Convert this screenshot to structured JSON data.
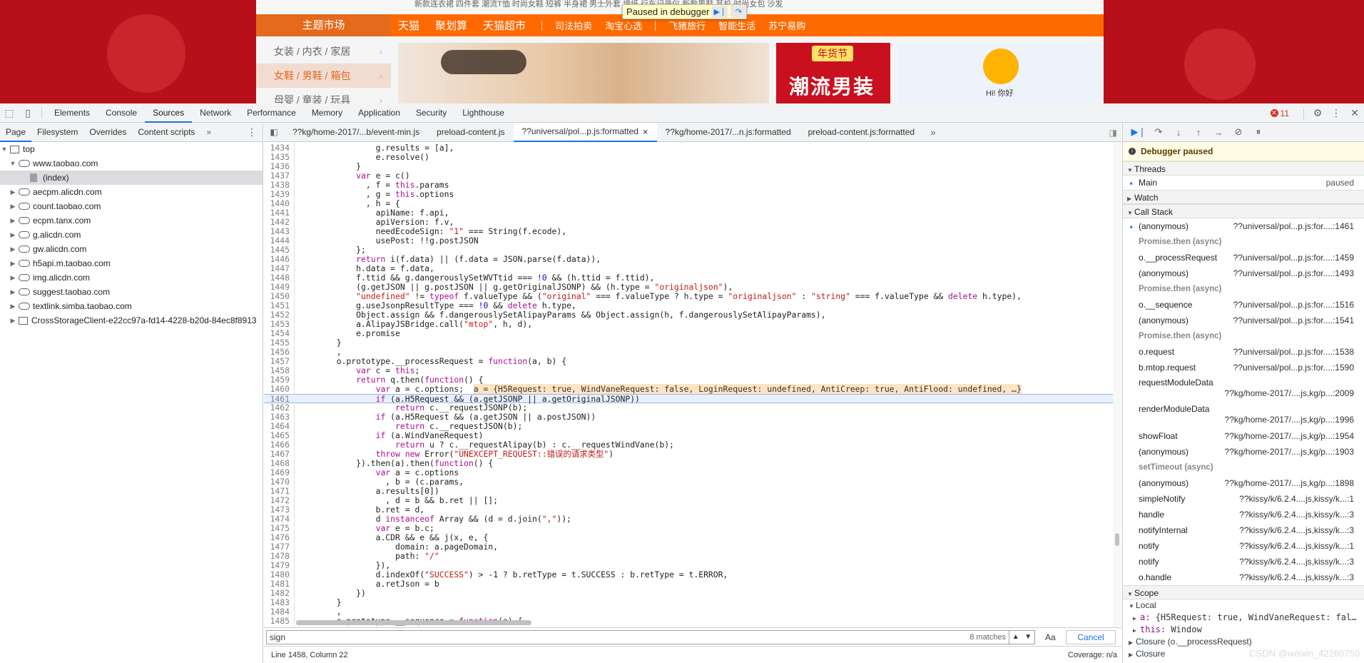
{
  "webpage": {
    "top_strip_text": "新款连衣裙 四件套 潮流T恤 时尚女鞋 短裤 半身裙 男士外套 墙纸 行车记录仪 新款男鞋 耳机 时尚女包 沙发",
    "theme_market": "主题市场",
    "nav": [
      "天猫",
      "聚划算",
      "天猫超市"
    ],
    "nav_small": [
      "司法拍卖",
      "淘宝心选",
      "飞猪旅行",
      "智能生活",
      "苏宁易购"
    ],
    "categories": [
      "女装 / 内衣 / 家居",
      "女鞋 / 男鞋 / 箱包",
      "母婴 / 童装 / 玩具"
    ],
    "banner2_tag": "年货节",
    "banner2_text": "潮流男装",
    "banner3_greeting": "Hi! 你好",
    "paused_overlay": "Paused in debugger"
  },
  "devtools": {
    "main_tabs": [
      "Elements",
      "Console",
      "Sources",
      "Network",
      "Performance",
      "Memory",
      "Application",
      "Security",
      "Lighthouse"
    ],
    "active_tab": "Sources",
    "error_count": "11",
    "navigator_tabs": [
      "Page",
      "Filesystem",
      "Overrides",
      "Content scripts"
    ],
    "tree": {
      "top": "top",
      "host": "www.taobao.com",
      "index": "(index)",
      "domains": [
        "aecpm.alicdn.com",
        "count.taobao.com",
        "ecpm.tanx.com",
        "g.alicdn.com",
        "gw.alicdn.com",
        "h5api.m.taobao.com",
        "img.alicdn.com",
        "suggest.taobao.com",
        "textlink.simba.taobao.com"
      ],
      "frame": "CrossStorageClient-e22cc97a-fd14-4228-b20d-84ec8f8913"
    },
    "file_tabs": [
      "??kg/home-2017/...b/event-min.js",
      "preload-content.js",
      "??universal/pol...p.js:formatted",
      "??kg/home-2017/...n.js:formatted",
      "preload-content.js:formatted"
    ],
    "active_file_tab": "??universal/pol...p.js:formatted",
    "search": {
      "query": "sign",
      "matches": "8 matches",
      "case_label": "Aa",
      "regex_label": ".*",
      "cancel": "Cancel"
    },
    "status": {
      "position": "Line 1458, Column 22",
      "coverage": "Coverage: n/a"
    },
    "debugger": {
      "paused": "Debugger paused",
      "threads_title": "Threads",
      "thread_name": "Main",
      "thread_state": "paused",
      "watch_title": "Watch",
      "callstack_title": "Call Stack",
      "scope_title": "Scope",
      "frames": [
        {
          "kind": "frame",
          "fn": "(anonymous)",
          "loc": "??universal/pol...p.js:for....:1461",
          "current": true
        },
        {
          "kind": "async",
          "label": "Promise.then (async)"
        },
        {
          "kind": "frame",
          "fn": "o.__processRequest",
          "loc": "??universal/pol...p.js:for....:1459"
        },
        {
          "kind": "frame",
          "fn": "(anonymous)",
          "loc": "??universal/pol...p.js:for....:1493"
        },
        {
          "kind": "async",
          "label": "Promise.then (async)"
        },
        {
          "kind": "frame",
          "fn": "o.__sequence",
          "loc": "??universal/pol...p.js:for....:1516"
        },
        {
          "kind": "frame",
          "fn": "(anonymous)",
          "loc": "??universal/pol...p.js:for....:1541"
        },
        {
          "kind": "async",
          "label": "Promise.then (async)"
        },
        {
          "kind": "frame",
          "fn": "o.request",
          "loc": "??universal/pol...p.js:for....:1538"
        },
        {
          "kind": "frame",
          "fn": "b.mtop.request",
          "loc": "??universal/pol...p.js:for....:1590"
        },
        {
          "kind": "tall",
          "fn": "requestModuleData",
          "loc": "??kg/home-2017/....js,kg/p...:2009"
        },
        {
          "kind": "tall",
          "fn": "renderModuleData",
          "loc": "??kg/home-2017/....js,kg/p...:1996"
        },
        {
          "kind": "frame",
          "fn": "showFloat",
          "loc": "??kg/home-2017/....js,kg/p...:1954"
        },
        {
          "kind": "frame",
          "fn": "(anonymous)",
          "loc": "??kg/home-2017/....js,kg/p...:1903"
        },
        {
          "kind": "async",
          "label": "setTimeout (async)"
        },
        {
          "kind": "frame",
          "fn": "(anonymous)",
          "loc": "??kg/home-2017/....js,kg/p...:1898"
        },
        {
          "kind": "frame",
          "fn": "simpleNotify",
          "loc": "??kissy/k/6.2.4....js,kissy/k...:1"
        },
        {
          "kind": "frame",
          "fn": "handle",
          "loc": "??kissy/k/6.2.4....js,kissy/k...:3"
        },
        {
          "kind": "frame",
          "fn": "notifyInternal",
          "loc": "??kissy/k/6.2.4....js,kissy/k...:3"
        },
        {
          "kind": "frame",
          "fn": "notify",
          "loc": "??kissy/k/6.2.4....js,kissy/k...:1"
        },
        {
          "kind": "frame",
          "fn": "notify",
          "loc": "??kissy/k/6.2.4....js,kissy/k...:3"
        },
        {
          "kind": "frame",
          "fn": "o.handle",
          "loc": "??kissy/k/6.2.4....js,kissy/k...:3"
        }
      ],
      "scope": {
        "local": "Local",
        "a_key": "a:",
        "a_val": "{H5Request: true, WindVaneRequest: fal…",
        "this_key": "this:",
        "this_val": "Window",
        "closure1": "Closure (o.__processRequest)",
        "closure2": "Closure"
      },
      "watermark": "CSDN @weixin_42260750"
    },
    "code_lines": [
      {
        "n": "1434",
        "t": "                g.results = [a],"
      },
      {
        "n": "1435",
        "t": "                e.resolve()"
      },
      {
        "n": "1436",
        "t": "            }"
      },
      {
        "n": "1437",
        "t": "            var e = c()"
      },
      {
        "n": "1438",
        "t": "              , f = this.params"
      },
      {
        "n": "1439",
        "t": "              , g = this.options"
      },
      {
        "n": "1440",
        "t": "              , h = {"
      },
      {
        "n": "1441",
        "t": "                apiName: f.api,"
      },
      {
        "n": "1442",
        "t": "                apiVersion: f.v,"
      },
      {
        "n": "1443",
        "t": "                needEcodeSign: \"1\" === String(f.ecode),"
      },
      {
        "n": "1444",
        "t": "                usePost: !!g.postJSON"
      },
      {
        "n": "1445",
        "t": "            };"
      },
      {
        "n": "1446",
        "t": "            return i(f.data) || (f.data = JSON.parse(f.data)),"
      },
      {
        "n": "1447",
        "t": "            h.data = f.data,"
      },
      {
        "n": "1448",
        "t": "            f.ttid && g.dangerouslySetWVTtid === !0 && (h.ttid = f.ttid),"
      },
      {
        "n": "1449",
        "t": "            (g.getJSON || g.postJSON || g.getOriginalJSONP) && (h.type = \"originaljson\"),"
      },
      {
        "n": "1450",
        "t": "            \"undefined\" != typeof f.valueType && (\"original\" === f.valueType ? h.type = \"originaljson\" : \"string\" === f.valueType && delete h.type),"
      },
      {
        "n": "1451",
        "t": "            g.useJsonpResultType === !0 && delete h.type,"
      },
      {
        "n": "1452",
        "t": "            Object.assign && f.dangerouslySetAlipayParams && Object.assign(h, f.dangerouslySetAlipayParams),"
      },
      {
        "n": "1453",
        "t": "            a.AlipayJSBridge.call(\"mtop\", h, d),"
      },
      {
        "n": "1454",
        "t": "            e.promise"
      },
      {
        "n": "1455",
        "t": "        }"
      },
      {
        "n": "1456",
        "t": "        ,"
      },
      {
        "n": "1457",
        "t": "        o.prototype.__processRequest = function(a, b) {"
      },
      {
        "n": "1458",
        "t": "            var c = this;"
      },
      {
        "n": "1459",
        "t": "            return q.then(function() {"
      },
      {
        "n": "1460",
        "t": "                var a = c.options;",
        "inline": "a = {H5Request: true, WindVaneRequest: false, LoginRequest: undefined, AntiCreep: true, AntiFlood: undefined, …}"
      },
      {
        "n": "1461",
        "t": "                if (a.H5Request && (a.getJSONP || a.getOriginalJSONP))",
        "exec": true
      },
      {
        "n": "1462",
        "t": "                    return c.__requestJSONP(b);"
      },
      {
        "n": "1463",
        "t": "                if (a.H5Request && (a.getJSON || a.postJSON))"
      },
      {
        "n": "1464",
        "t": "                    return c.__requestJSON(b);"
      },
      {
        "n": "1465",
        "t": "                if (a.WindVaneRequest)"
      },
      {
        "n": "1466",
        "t": "                    return u ? c.__requestAlipay(b) : c.__requestWindVane(b);"
      },
      {
        "n": "1467",
        "t": "                throw new Error(\"UNEXCEPT_REQUEST::错误的请求类型\")"
      },
      {
        "n": "1468",
        "t": "            }).then(a).then(function() {"
      },
      {
        "n": "1469",
        "t": "                var a = c.options"
      },
      {
        "n": "1470",
        "t": "                  , b = (c.params,"
      },
      {
        "n": "1471",
        "t": "                a.results[0])"
      },
      {
        "n": "1472",
        "t": "                  , d = b && b.ret || [];"
      },
      {
        "n": "1473",
        "t": "                b.ret = d,"
      },
      {
        "n": "1474",
        "t": "                d instanceof Array && (d = d.join(\",\"));"
      },
      {
        "n": "1475",
        "t": "                var e = b.c;"
      },
      {
        "n": "1476",
        "t": "                a.CDR && e && j(x, e, {"
      },
      {
        "n": "1477",
        "t": "                    domain: a.pageDomain,"
      },
      {
        "n": "1478",
        "t": "                    path: \"/\""
      },
      {
        "n": "1479",
        "t": "                }),"
      },
      {
        "n": "1480",
        "t": "                d.indexOf(\"SUCCESS\") > -1 ? b.retType = t.SUCCESS : b.retType = t.ERROR,"
      },
      {
        "n": "1481",
        "t": "                a.retJson = b"
      },
      {
        "n": "1482",
        "t": "            })"
      },
      {
        "n": "1483",
        "t": "        }"
      },
      {
        "n": "1484",
        "t": "        ,"
      },
      {
        "n": "1485",
        "t": "        o.prototype.__sequence = function(a) {"
      }
    ]
  }
}
